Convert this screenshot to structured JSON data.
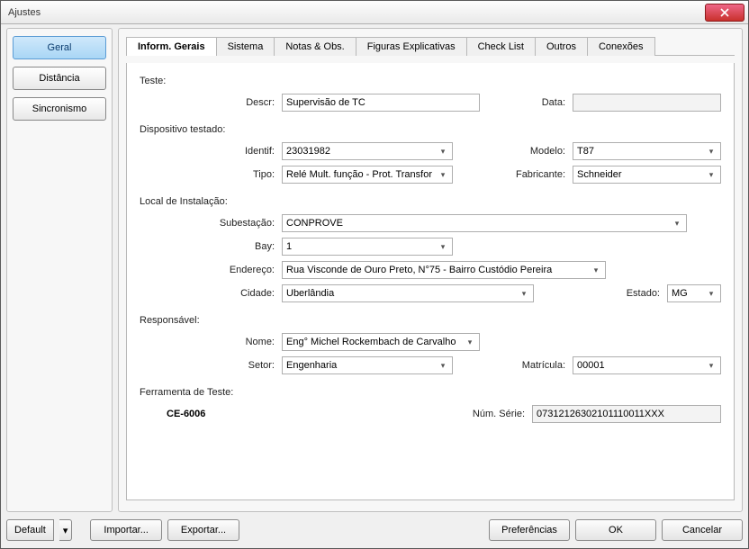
{
  "window": {
    "title": "Ajustes"
  },
  "sidebar": {
    "items": [
      {
        "label": "Geral"
      },
      {
        "label": "Distância"
      },
      {
        "label": "Sincronismo"
      }
    ]
  },
  "tabs": [
    {
      "label": "Inform. Gerais"
    },
    {
      "label": "Sistema"
    },
    {
      "label": "Notas & Obs."
    },
    {
      "label": "Figuras Explicativas"
    },
    {
      "label": "Check List"
    },
    {
      "label": "Outros"
    },
    {
      "label": "Conexões"
    }
  ],
  "sections": {
    "teste": {
      "title": "Teste:",
      "descr_label": "Descr:",
      "descr_value": "Supervisão de TC",
      "data_label": "Data:",
      "data_value": ""
    },
    "dispositivo": {
      "title": "Dispositivo testado:",
      "identif_label": "Identif:",
      "identif_value": "23031982",
      "modelo_label": "Modelo:",
      "modelo_value": "T87",
      "tipo_label": "Tipo:",
      "tipo_value": "Relé Mult. função - Prot. Transfor",
      "fabricante_label": "Fabricante:",
      "fabricante_value": "Schneider"
    },
    "local": {
      "title": "Local de Instalação:",
      "subestacao_label": "Subestação:",
      "subestacao_value": "CONPROVE",
      "bay_label": "Bay:",
      "bay_value": "1",
      "endereco_label": "Endereço:",
      "endereco_value": "Rua Visconde de Ouro Preto, N°75 - Bairro Custódio Pereira",
      "cidade_label": "Cidade:",
      "cidade_value": "Uberlândia",
      "estado_label": "Estado:",
      "estado_value": "MG"
    },
    "responsavel": {
      "title": "Responsável:",
      "nome_label": "Nome:",
      "nome_value": "Eng° Michel Rockembach de Carvalho",
      "setor_label": "Setor:",
      "setor_value": "Engenharia",
      "matricula_label": "Matrícula:",
      "matricula_value": "00001"
    },
    "ferramenta": {
      "title": "Ferramenta de Teste:",
      "tool_name": "CE-6006",
      "serie_label": "Núm. Série:",
      "serie_value": "07312126302101110011XXX"
    }
  },
  "footer": {
    "default": "Default",
    "importar": "Importar...",
    "exportar": "Exportar...",
    "preferencias": "Preferências",
    "ok": "OK",
    "cancelar": "Cancelar"
  }
}
